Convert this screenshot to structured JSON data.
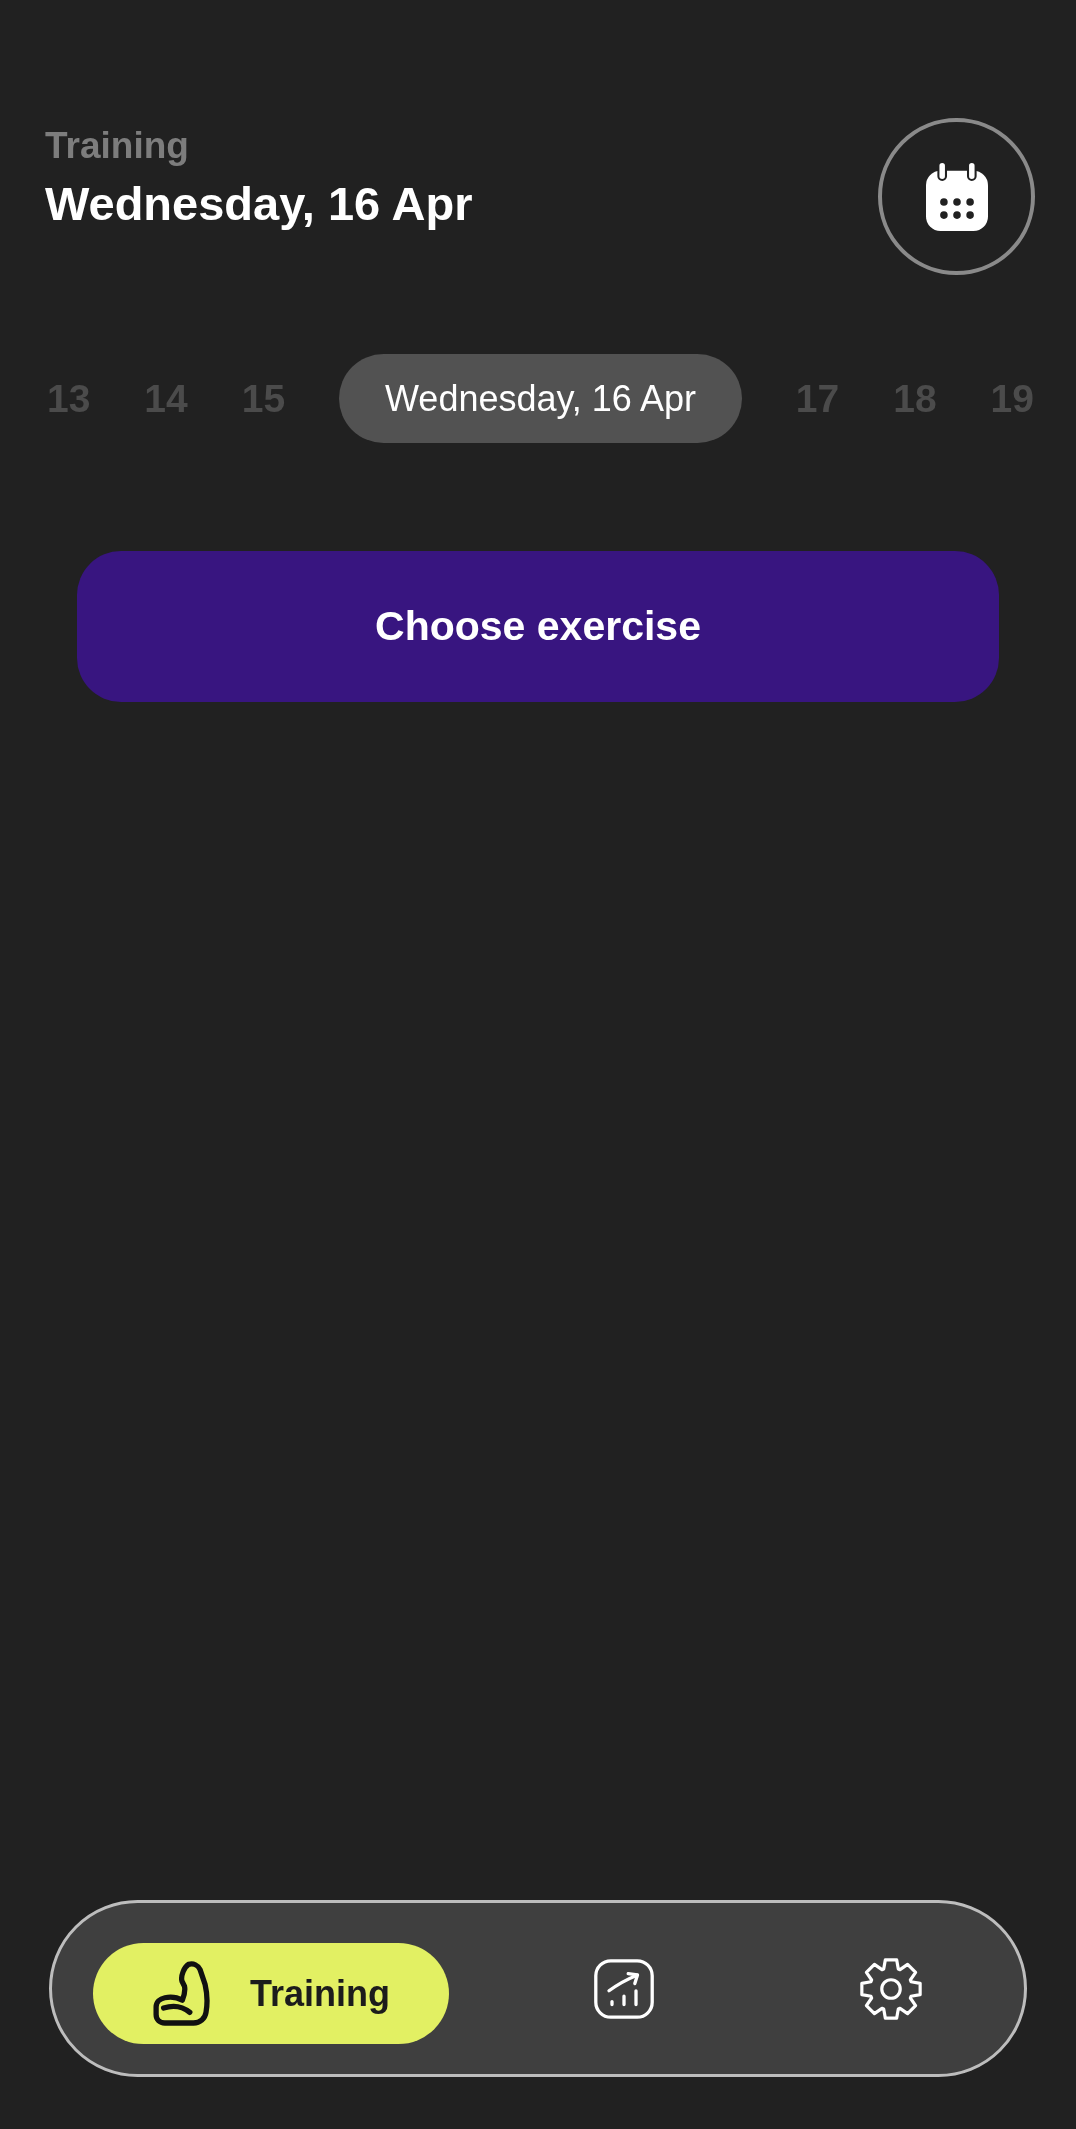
{
  "header": {
    "section": "Training",
    "title": "Wednesday, 16 Apr"
  },
  "date_strip": [
    {
      "label": "13",
      "selected": false
    },
    {
      "label": "14",
      "selected": false
    },
    {
      "label": "15",
      "selected": false
    },
    {
      "label": "Wednesday, 16 Apr",
      "selected": true
    },
    {
      "label": "17",
      "selected": false
    },
    {
      "label": "18",
      "selected": false
    },
    {
      "label": "19",
      "selected": false
    }
  ],
  "primary_button": {
    "label": "Choose exercise"
  },
  "bottom_nav": [
    {
      "kind": "training",
      "label": "Training",
      "selected": true
    },
    {
      "kind": "stats",
      "selected": false
    },
    {
      "kind": "settings",
      "selected": false
    }
  ]
}
